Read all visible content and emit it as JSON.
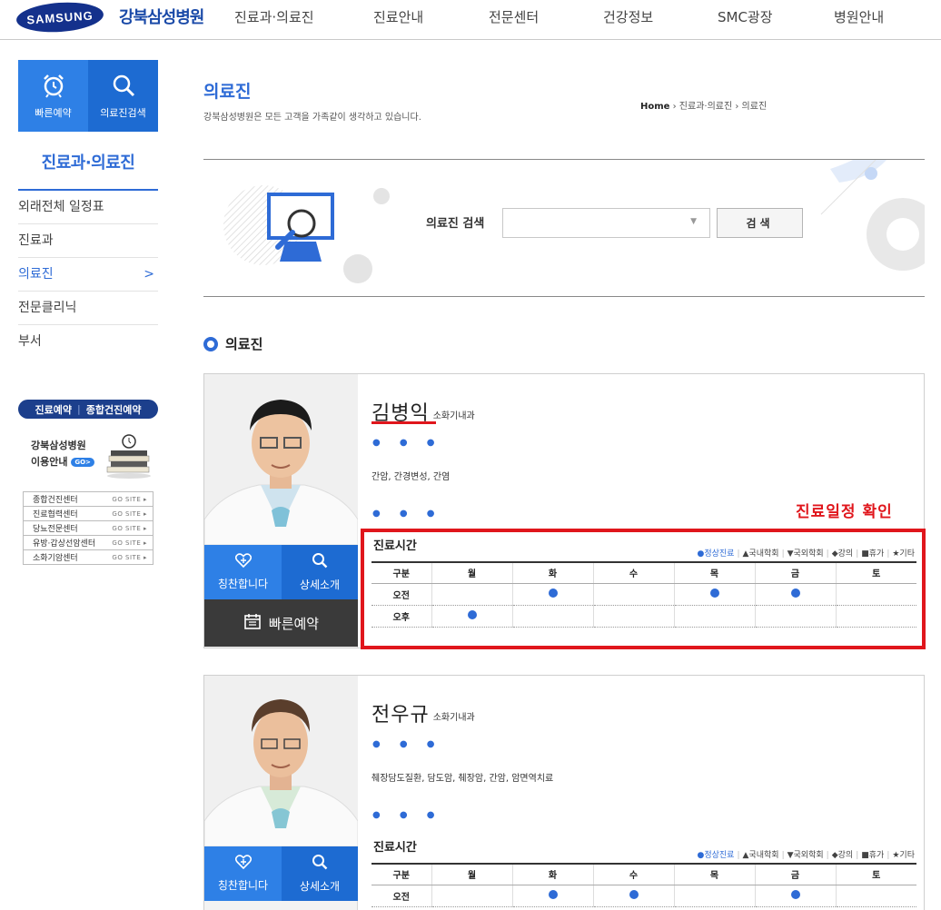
{
  "header": {
    "logo_text": "SAMSUNG",
    "hospital_name": "강북삼성병원",
    "menu": [
      "진료과·의료진",
      "진료안내",
      "전문센터",
      "건강정보",
      "SMC광장",
      "병원안내"
    ]
  },
  "sidebar": {
    "quick": [
      {
        "label": "빠른예약",
        "icon": "alarm-clock-icon"
      },
      {
        "label": "의료진검색",
        "icon": "search-icon"
      }
    ],
    "title": "진료과·의료진",
    "items": [
      {
        "label": "외래전체 일정표"
      },
      {
        "label": "진료과"
      },
      {
        "label": "의료진",
        "arrow": ">"
      },
      {
        "label": "전문클리닉"
      },
      {
        "label": "부서"
      }
    ],
    "reserve_tabs": [
      "진료예약",
      "종합건진예약"
    ],
    "guide_line1": "강북삼성병원",
    "guide_line2": "이용안내",
    "go_badge": "GO>",
    "sites": [
      {
        "name": "종합건진센터",
        "go": "GO SITE ▸"
      },
      {
        "name": "진료협력센터",
        "go": "GO SITE ▸"
      },
      {
        "name": "당뇨전문센터",
        "go": "GO SITE ▸"
      },
      {
        "name": "유방·갑상선암센터",
        "go": "GO SITE ▸"
      },
      {
        "name": "소화기암센터",
        "go": "GO SITE ▸"
      }
    ]
  },
  "page": {
    "title": "의료진",
    "subtitle": "강북삼성병원은 모든 고객을 가족같이 생각하고 있습니다.",
    "breadcrumb_home": "Home",
    "breadcrumb_rest": " › 진료과·의료진 › 의료진"
  },
  "search": {
    "label": "의료진 검색",
    "select_value": "",
    "button": "검색"
  },
  "section_title": "의료진",
  "schedule_labels": {
    "title": "진료시간",
    "legend": [
      "●정상진료",
      "▲국내학회",
      "▼국외학회",
      "◆강의",
      "■휴가",
      "★기타"
    ],
    "columns": [
      "구분",
      "월",
      "화",
      "수",
      "목",
      "금",
      "토"
    ],
    "praise": "칭찬합니다",
    "detail": "상세소개",
    "reserve": "빠른예약",
    "dots": "● ● ●"
  },
  "annotation_text": "진료일정 확인",
  "doctors": [
    {
      "name": "김병익",
      "dept": "소화기내과",
      "specialty": "간암, 간경변성, 간염",
      "rows": [
        {
          "label": "오전",
          "slots": [
            false,
            true,
            false,
            true,
            true,
            false
          ]
        },
        {
          "label": "오후",
          "slots": [
            true,
            false,
            false,
            false,
            false,
            false
          ]
        }
      ]
    },
    {
      "name": "전우규",
      "dept": "소화기내과",
      "specialty": "췌장담도질환, 담도암, 췌장암, 간암, 암면역치료",
      "rows": [
        {
          "label": "오전",
          "slots": [
            false,
            true,
            true,
            false,
            true,
            false
          ]
        }
      ]
    }
  ],
  "colors": {
    "primary": "#2e6bd6",
    "quick_bg": "#2e80e6",
    "dark_btn": "#3a3a3a",
    "highlight": "#e0161c",
    "logo": "#14318c"
  }
}
